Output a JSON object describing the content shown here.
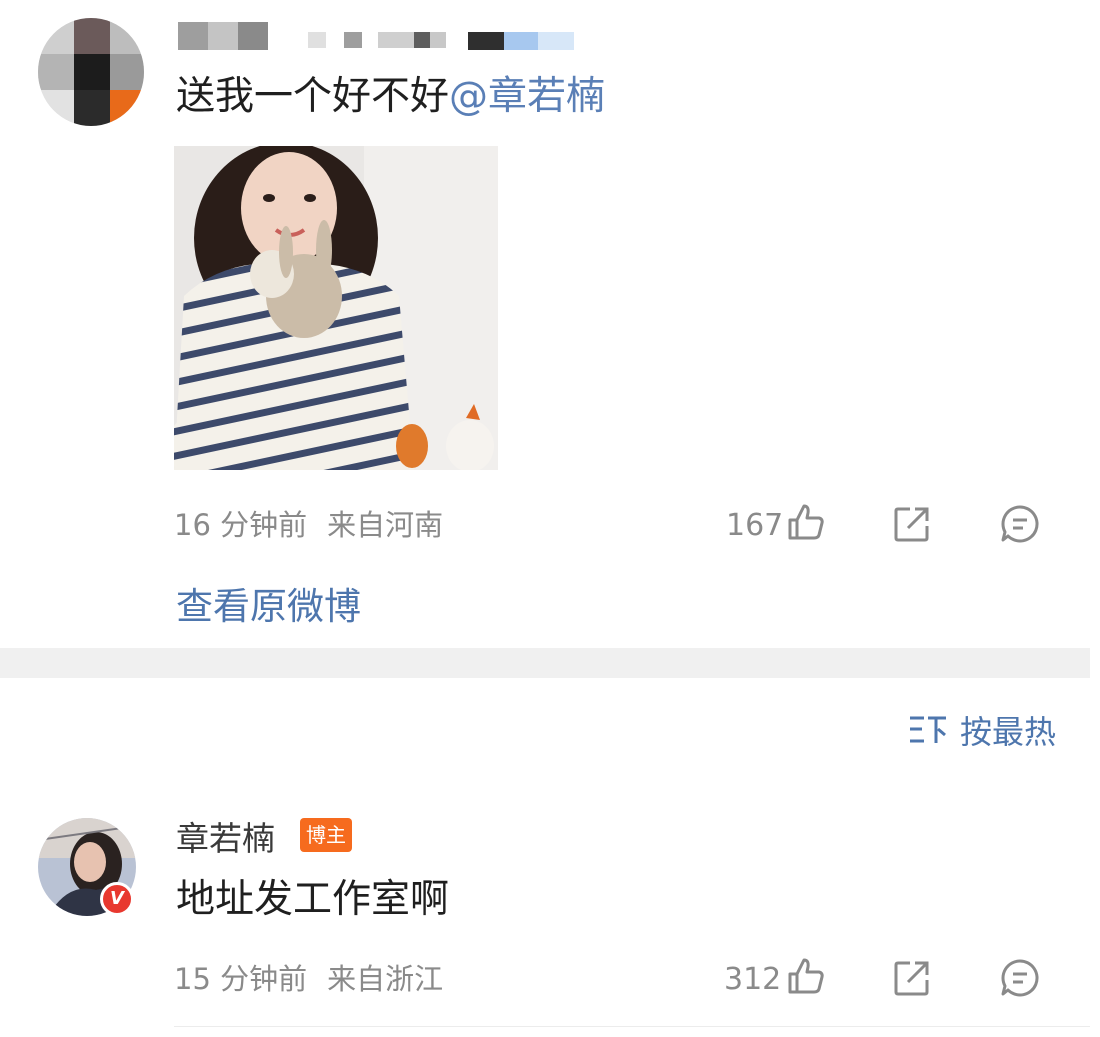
{
  "post": {
    "text": "送我一个好不好",
    "mention": "@章若楠",
    "time": "16 分钟前",
    "location": "来自河南",
    "like_count": "167",
    "view_original_label": "查看原微博"
  },
  "sort": {
    "label": "按最热"
  },
  "comment": {
    "author": "章若楠",
    "badge": "博主",
    "verified_mark": "V",
    "text": "地址发工作室啊",
    "time": "15 分钟前",
    "location": "来自浙江",
    "like_count": "312"
  },
  "colors": {
    "link": "#4e76ad",
    "mention": "#5a7fb6",
    "meta_gray": "#8a8a8a",
    "badge_orange": "#f66b1e",
    "verified_red": "#e8382f",
    "divider": "#f0f0f0"
  },
  "icons": [
    "thumbs-up-icon",
    "share-icon",
    "comment-icon",
    "sort-icon",
    "verified-icon"
  ]
}
